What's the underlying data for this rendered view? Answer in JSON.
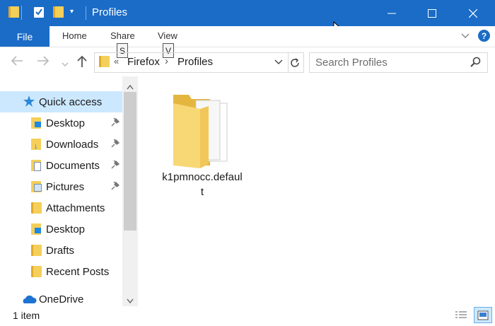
{
  "window": {
    "title": "Profiles",
    "controls": {
      "minimize": "—",
      "maximize": "☐",
      "close": "✕"
    }
  },
  "ribbon": {
    "file": "File",
    "tabs": [
      {
        "label": "Home"
      },
      {
        "label": "Share",
        "keytip": "S"
      },
      {
        "label": "View",
        "keytip": "V"
      }
    ]
  },
  "address": {
    "overflow": "«",
    "crumbs": [
      "Firefox",
      "Profiles"
    ],
    "separator": "›"
  },
  "search": {
    "placeholder": "Search Profiles"
  },
  "sidebar": {
    "items": [
      {
        "label": "Quick access",
        "icon": "star-icon",
        "selected": true
      },
      {
        "label": "Desktop",
        "icon": "desktop-folder-icon",
        "pinned": true
      },
      {
        "label": "Downloads",
        "icon": "downloads-folder-icon",
        "pinned": true
      },
      {
        "label": "Documents",
        "icon": "documents-folder-icon",
        "pinned": true
      },
      {
        "label": "Pictures",
        "icon": "pictures-folder-icon",
        "pinned": true
      },
      {
        "label": "Attachments",
        "icon": "folder-icon"
      },
      {
        "label": "Desktop",
        "icon": "desktop-folder-icon"
      },
      {
        "label": "Drafts",
        "icon": "folder-icon"
      },
      {
        "label": "Recent Posts",
        "icon": "folder-icon"
      },
      {
        "label": "OneDrive",
        "icon": "onedrive-icon"
      }
    ]
  },
  "content": {
    "items": [
      {
        "name_line1": "k1pmnocc.defaul",
        "name_line2": "t",
        "icon": "folder-with-files-icon"
      }
    ]
  },
  "status": {
    "count": "1 item"
  },
  "colors": {
    "accent": "#1a6cc7",
    "selected": "#cce8ff"
  }
}
